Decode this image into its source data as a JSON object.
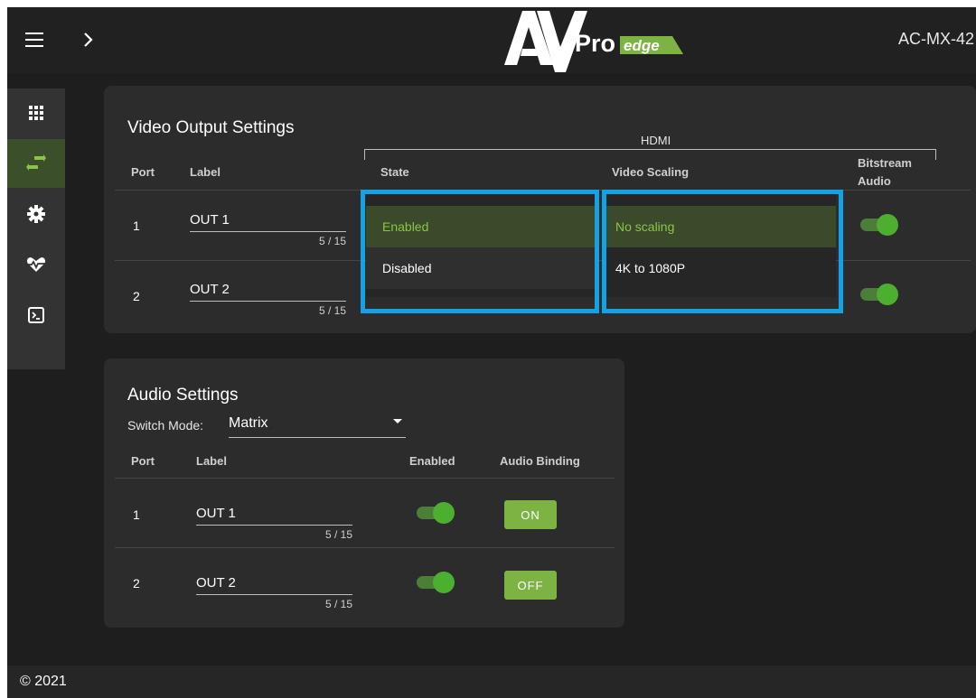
{
  "header": {
    "model": "AC-MX-42",
    "logo": {
      "av": "AV",
      "pro": "Pro",
      "edge": "edge"
    }
  },
  "sidebar": {
    "items": [
      {
        "icon": "grid-icon",
        "label": ""
      },
      {
        "icon": "swap-arrows-icon",
        "label": "",
        "active": true
      },
      {
        "icon": "gear-icon",
        "label": ""
      },
      {
        "icon": "heartbeat-icon",
        "label": ""
      },
      {
        "icon": "terminal-icon",
        "label": ""
      }
    ]
  },
  "video_output": {
    "title": "Video Output Settings",
    "group_header": "HDMI",
    "columns": {
      "port": "Port",
      "label": "Label",
      "state": "State",
      "scaling": "Video Scaling",
      "bitstream_line1": "Bitstream",
      "bitstream_line2": "Audio"
    },
    "rows": [
      {
        "port": "1",
        "label": "OUT 1",
        "count": "5 / 15",
        "bitstream": true
      },
      {
        "port": "2",
        "label": "OUT 2",
        "count": "5 / 15",
        "bitstream": true
      }
    ],
    "state_dropdown": {
      "options": [
        "Enabled",
        "Disabled"
      ],
      "selected": "Enabled"
    },
    "scaling_dropdown": {
      "options": [
        "No scaling",
        "4K to 1080P"
      ],
      "selected": "No scaling"
    }
  },
  "audio": {
    "title": "Audio Settings",
    "switch_mode_label": "Switch Mode:",
    "switch_mode_value": "Matrix",
    "columns": {
      "port": "Port",
      "label": "Label",
      "enabled": "Enabled",
      "binding": "Audio Binding"
    },
    "rows": [
      {
        "port": "1",
        "label": "OUT 1",
        "count": "5 / 15",
        "enabled": true,
        "binding": "ON"
      },
      {
        "port": "2",
        "label": "OUT 2",
        "count": "5 / 15",
        "enabled": true,
        "binding": "OFF"
      }
    ]
  },
  "footer": {
    "copyright": "© 2021"
  },
  "colors": {
    "accent_green": "#8bc34a",
    "toggle_green": "#4caf2f",
    "highlight_blue": "#13a2e6",
    "button_green": "#7cb342"
  }
}
